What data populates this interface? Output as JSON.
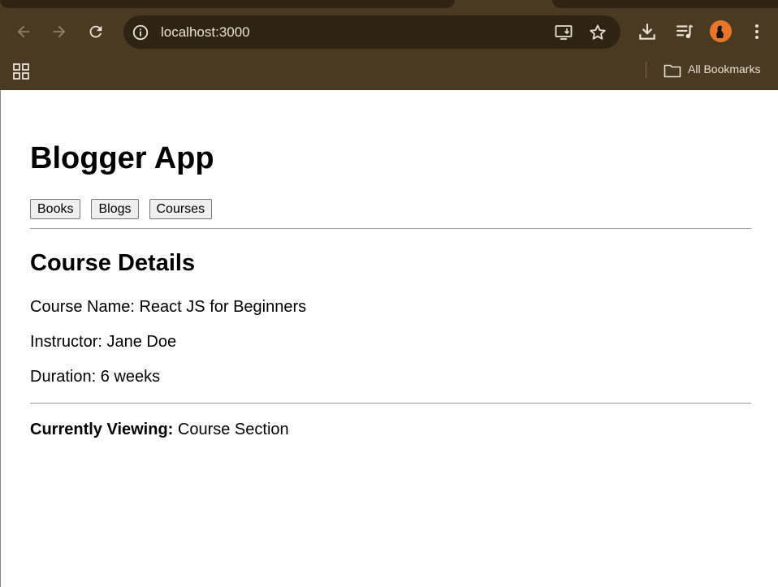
{
  "browser": {
    "url": "localhost:3000",
    "bookmarks_label": "All Bookmarks",
    "icons": {
      "back": "back-arrow-icon",
      "forward": "forward-arrow-icon",
      "reload": "reload-icon",
      "site_info": "info-icon",
      "install": "install-app-icon",
      "bookmark": "star-icon",
      "downloads": "download-icon",
      "media": "media-queue-icon",
      "profile": "avatar",
      "menu": "more-vert-icon",
      "apps": "apps-grid-icon",
      "folder": "folder-icon"
    },
    "colors": {
      "frame": "#4a3a22",
      "omnibox": "#2e2414",
      "text": "#e8e1d6"
    }
  },
  "page": {
    "title": "Blogger App",
    "nav": [
      "Books",
      "Blogs",
      "Courses"
    ],
    "section_title": "Course Details",
    "details": [
      "Course Name: React JS for Beginners",
      "Instructor: Jane Doe",
      "Duration: 6 weeks"
    ],
    "viewing_label": "Currently Viewing:",
    "viewing_value": "Course Section"
  }
}
